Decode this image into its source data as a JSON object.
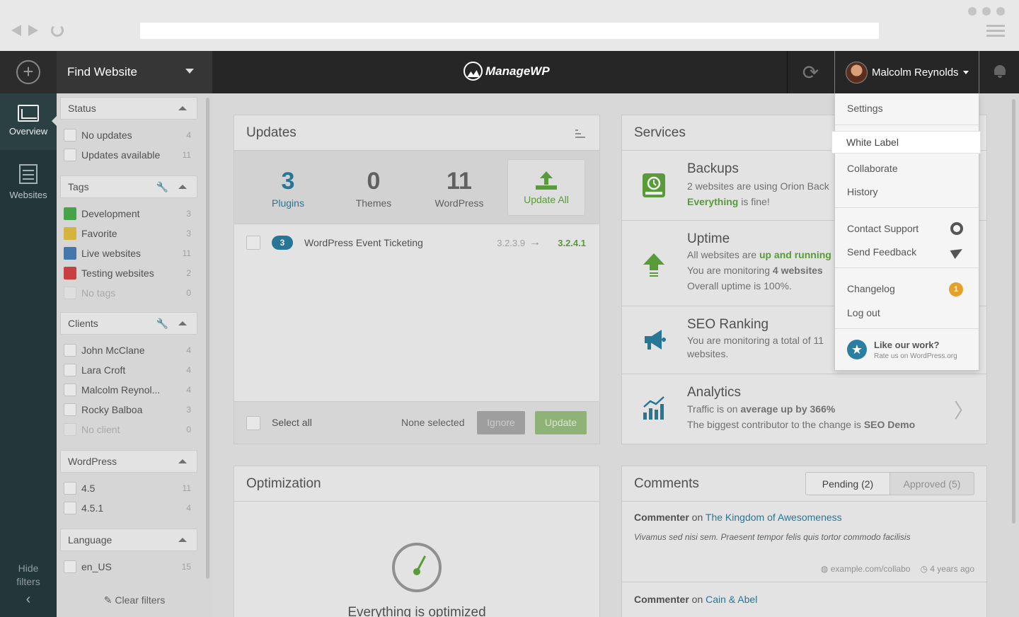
{
  "topbar": {
    "find_website": "Find Website",
    "logo_text": "ManageWP",
    "user_name": "Malcolm Reynolds"
  },
  "rail": {
    "overview": "Overview",
    "websites": "Websites",
    "hide_filters": "Hide filters"
  },
  "filters": {
    "status": {
      "title": "Status",
      "items": [
        {
          "label": "No updates",
          "count": "4"
        },
        {
          "label": "Updates available",
          "count": "11"
        }
      ]
    },
    "tags": {
      "title": "Tags",
      "items": [
        {
          "label": "Development",
          "count": "3",
          "color": "#4cae4c"
        },
        {
          "label": "Favorite",
          "count": "3",
          "color": "#e2c040"
        },
        {
          "label": "Live websites",
          "count": "11",
          "color": "#4a7fb5"
        },
        {
          "label": "Testing websites",
          "count": "2",
          "color": "#d64545"
        },
        {
          "label": "No tags",
          "count": "0"
        }
      ]
    },
    "clients": {
      "title": "Clients",
      "items": [
        {
          "label": "John McClane",
          "count": "4"
        },
        {
          "label": "Lara Croft",
          "count": "4"
        },
        {
          "label": "Malcolm Reynol...",
          "count": "4"
        },
        {
          "label": "Rocky Balboa",
          "count": "3"
        },
        {
          "label": "No client",
          "count": "0"
        }
      ]
    },
    "wordpress": {
      "title": "WordPress",
      "items": [
        {
          "label": "4.5",
          "count": "11"
        },
        {
          "label": "4.5.1",
          "count": "4"
        }
      ]
    },
    "language": {
      "title": "Language",
      "items": [
        {
          "label": "en_US",
          "count": "15"
        }
      ]
    },
    "clear": "Clear filters"
  },
  "updates": {
    "title": "Updates",
    "stats": [
      {
        "num": "3",
        "label": "Plugins"
      },
      {
        "num": "0",
        "label": "Themes"
      },
      {
        "num": "11",
        "label": "WordPress"
      }
    ],
    "update_all": "Update All",
    "item": {
      "count": "3",
      "name": "WordPress Event Ticketing",
      "from": "3.2.3.9",
      "to": "3.2.4.1"
    },
    "select_all": "Select all",
    "none_selected": "None selected",
    "ignore": "Ignore",
    "update": "Update"
  },
  "services": {
    "title": "Services",
    "backups": {
      "title": "Backups",
      "line1": "2 websites are using Orion Back",
      "line2_bold": "Everything",
      "line2_rest": " is fine!"
    },
    "uptime": {
      "title": "Uptime",
      "line1_a": "All websites are ",
      "line1_b": "up and running",
      "line2_a": "You are monitoring ",
      "line2_b": "4 websites",
      "line3": "Overall uptime is 100%."
    },
    "seo": {
      "title": "SEO Ranking",
      "line1": "You are monitoring a total of 11",
      "line2": "websites."
    },
    "analytics": {
      "title": "Analytics",
      "line1_a": "Traffic is on ",
      "line1_b": "average up by 366%",
      "line2_a": "The biggest contributor to the change is ",
      "line2_b": "SEO Demo"
    }
  },
  "optimization": {
    "title": "Optimization",
    "text": "Everything is optimized"
  },
  "comments": {
    "title": "Comments",
    "tab_pending": "Pending (2)",
    "tab_approved": "Approved (5)",
    "c1": {
      "author": "Commenter",
      "on": " on ",
      "post": "The Kingdom of Awesomeness",
      "text": "Vivamus sed nisi sem. Praesent tempor felis quis tortor commodo facilisis",
      "url": "example.com/collabo",
      "time": "4 years ago"
    },
    "c2": {
      "author": "Commenter",
      "on": " on ",
      "post": "Cain & Abel"
    }
  },
  "dropdown": {
    "settings": "Settings",
    "white_label": "White Label",
    "collaborate": "Collaborate",
    "history": "History",
    "contact_support": "Contact Support",
    "send_feedback": "Send Feedback",
    "changelog": "Changelog",
    "changelog_count": "1",
    "log_out": "Log out",
    "like_title": "Like our work?",
    "like_sub": "Rate us on WordPress.org"
  }
}
